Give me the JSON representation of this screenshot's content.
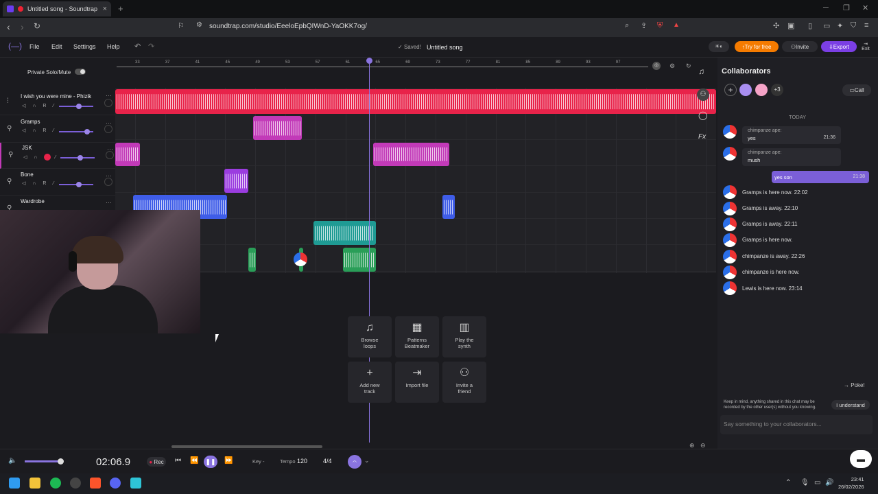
{
  "browser": {
    "tab_title": "Untitled song - Soundtrap",
    "url": "soundtrap.com/studio/EeeloEpbQIWnD-YaOKK7og/"
  },
  "app": {
    "menu": [
      "File",
      "Edit",
      "Settings",
      "Help"
    ],
    "saved": "Saved!",
    "song_title": "Untitled song",
    "try_free": "Try for free",
    "invite": "Invite",
    "export": "Export",
    "exit": "Exit"
  },
  "tracks": {
    "private_solo": "Private Solo/Mute",
    "list": [
      {
        "name": "I wish you were mine - Phizik"
      },
      {
        "name": "Gramps"
      },
      {
        "name": "JSK"
      },
      {
        "name": "Bone"
      },
      {
        "name": "Wardrobe"
      }
    ],
    "ctrl_r": "R"
  },
  "ruler": {
    "bars": [
      "33",
      "37",
      "41",
      "45",
      "49",
      "53",
      "57",
      "61",
      "65",
      "69",
      "73",
      "77",
      "81",
      "85",
      "89",
      "93",
      "97"
    ]
  },
  "actions": [
    {
      "icon": "♫",
      "label": "Browse loops"
    },
    {
      "icon": "▦",
      "label": "Patterns Beatmaker"
    },
    {
      "icon": "▥",
      "label": "Play the synth"
    },
    {
      "icon": "+",
      "label": "Add new track"
    },
    {
      "icon": "⇥",
      "label": "Import file"
    },
    {
      "icon": "⚇",
      "label": "Invite a friend"
    }
  ],
  "collab": {
    "title": "Collaborators",
    "extra_count": "+3",
    "call": "Call",
    "today": "TODAY",
    "messages": [
      {
        "who": "chimpanze ape:",
        "text": "yes",
        "time": "21:36"
      },
      {
        "who": "chimpanze ape:",
        "text": "mush",
        "time": ""
      }
    ],
    "my_message": {
      "text": "yes son",
      "time": "21:38"
    },
    "statuses": [
      "Gramps is here now. 22:02",
      "Gramps is away. 22:10",
      "Gramps is away. 22:11",
      "Gramps is here now.",
      "chimpanze is away. 22:26",
      "chimpanze is here now.",
      "Lewis is here now. 23:14"
    ],
    "poke": "Poke!",
    "warning": "Keep in mind, anything shared in this chat may be recorded by the other user(s) without you knowing.",
    "understand": "I understand",
    "input_placeholder": "Say something to your collaborators..."
  },
  "transport": {
    "time": "02:06.9",
    "rec": "Rec",
    "key_label": "Key -",
    "tempo_label": "Tempo",
    "tempo": "120",
    "time_signature": "4/4"
  },
  "taskbar": {
    "time": "23:41",
    "date": "26/02/2026"
  },
  "colors": {
    "accent": "#8a74e0",
    "track1": "#e8234a",
    "track2": "#c23ab8",
    "track5": "#3f5de8",
    "teal": "#1f9b94",
    "green": "#2a9e58",
    "try_free": "#f57b00"
  }
}
